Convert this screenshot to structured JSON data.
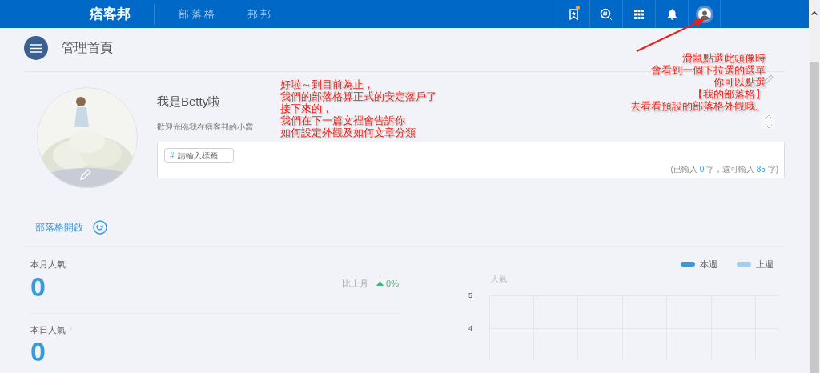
{
  "top_bar": {
    "logo": "痞客邦",
    "nav": [
      {
        "label": "部落格",
        "selected": false
      },
      {
        "label": "邦邦",
        "selected": false
      }
    ],
    "notice_dot": true
  },
  "header": {
    "title": "管理首頁"
  },
  "profile": {
    "name": "我是Betty啦",
    "subtitle": "歡迎光臨我在痞客邦的小窩",
    "tag_field": {
      "placeholder": "請輸入標籤",
      "hash": "#"
    },
    "counter": {
      "before": "(已輸入 ",
      "typed": "0",
      "middle": " 字，還可輸入 ",
      "remaining": "85",
      "after": " 字)"
    }
  },
  "blog_toggle": {
    "label": "部落格開啟"
  },
  "stats": [
    {
      "label": "本月人氣",
      "value": "0",
      "compare_label": "比上月",
      "change": "0%"
    },
    {
      "label": "本日人氣",
      "value": "0"
    }
  ],
  "chart": {
    "legend": [
      {
        "name": "本週",
        "color": "#3a9ad9"
      },
      {
        "name": "上週",
        "color": "#9fd0f0"
      }
    ],
    "ylabel": "人氣",
    "yticks": [
      "5",
      "4"
    ]
  },
  "annotations": [
    {
      "lines": [
        "好啦～到目前為止，",
        "我們的部落格算正式的安定落戶了",
        "接下來的，",
        "我們在下一篇文裡會告訴你",
        "如何設定外觀及如何文章分類"
      ]
    },
    {
      "lines": [
        "滑鼠點選此頭像時",
        "會看到一個下拉選的選單",
        "你可以點選",
        "【我的部落格】",
        "去看看預設的部落格外觀哦。"
      ]
    }
  ]
}
